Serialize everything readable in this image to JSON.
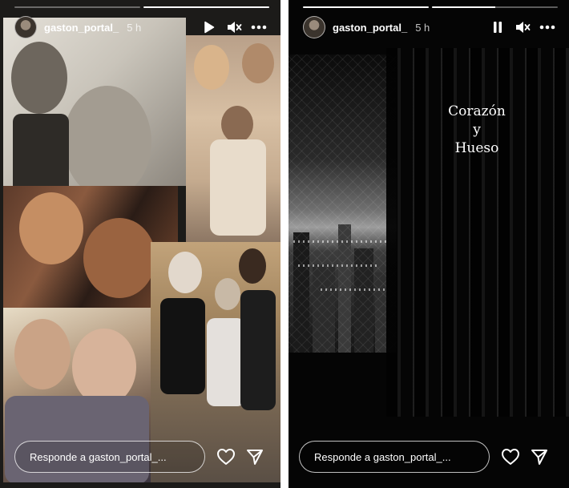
{
  "stories": [
    {
      "id": "left",
      "username": "gaston_portal_",
      "time": "5 h",
      "progress": [
        0.0,
        1.0
      ],
      "controls": {
        "play_pause": "play-icon",
        "sound": "muted-speaker-icon",
        "more": "more-dots-icon"
      },
      "reply_placeholder": "Responde a gaston_portal_...",
      "caption": []
    },
    {
      "id": "right",
      "username": "gaston_portal_",
      "time": "5 h",
      "progress": [
        1.0,
        0.5
      ],
      "controls": {
        "play_pause": "pause-icon",
        "sound": "muted-speaker-icon",
        "more": "more-dots-icon"
      },
      "reply_placeholder": "Responde a gaston_portal_...",
      "caption": [
        "Corazón",
        "y",
        "Hueso"
      ]
    }
  ],
  "icons": {
    "like": "heart-icon",
    "share": "send-icon"
  }
}
